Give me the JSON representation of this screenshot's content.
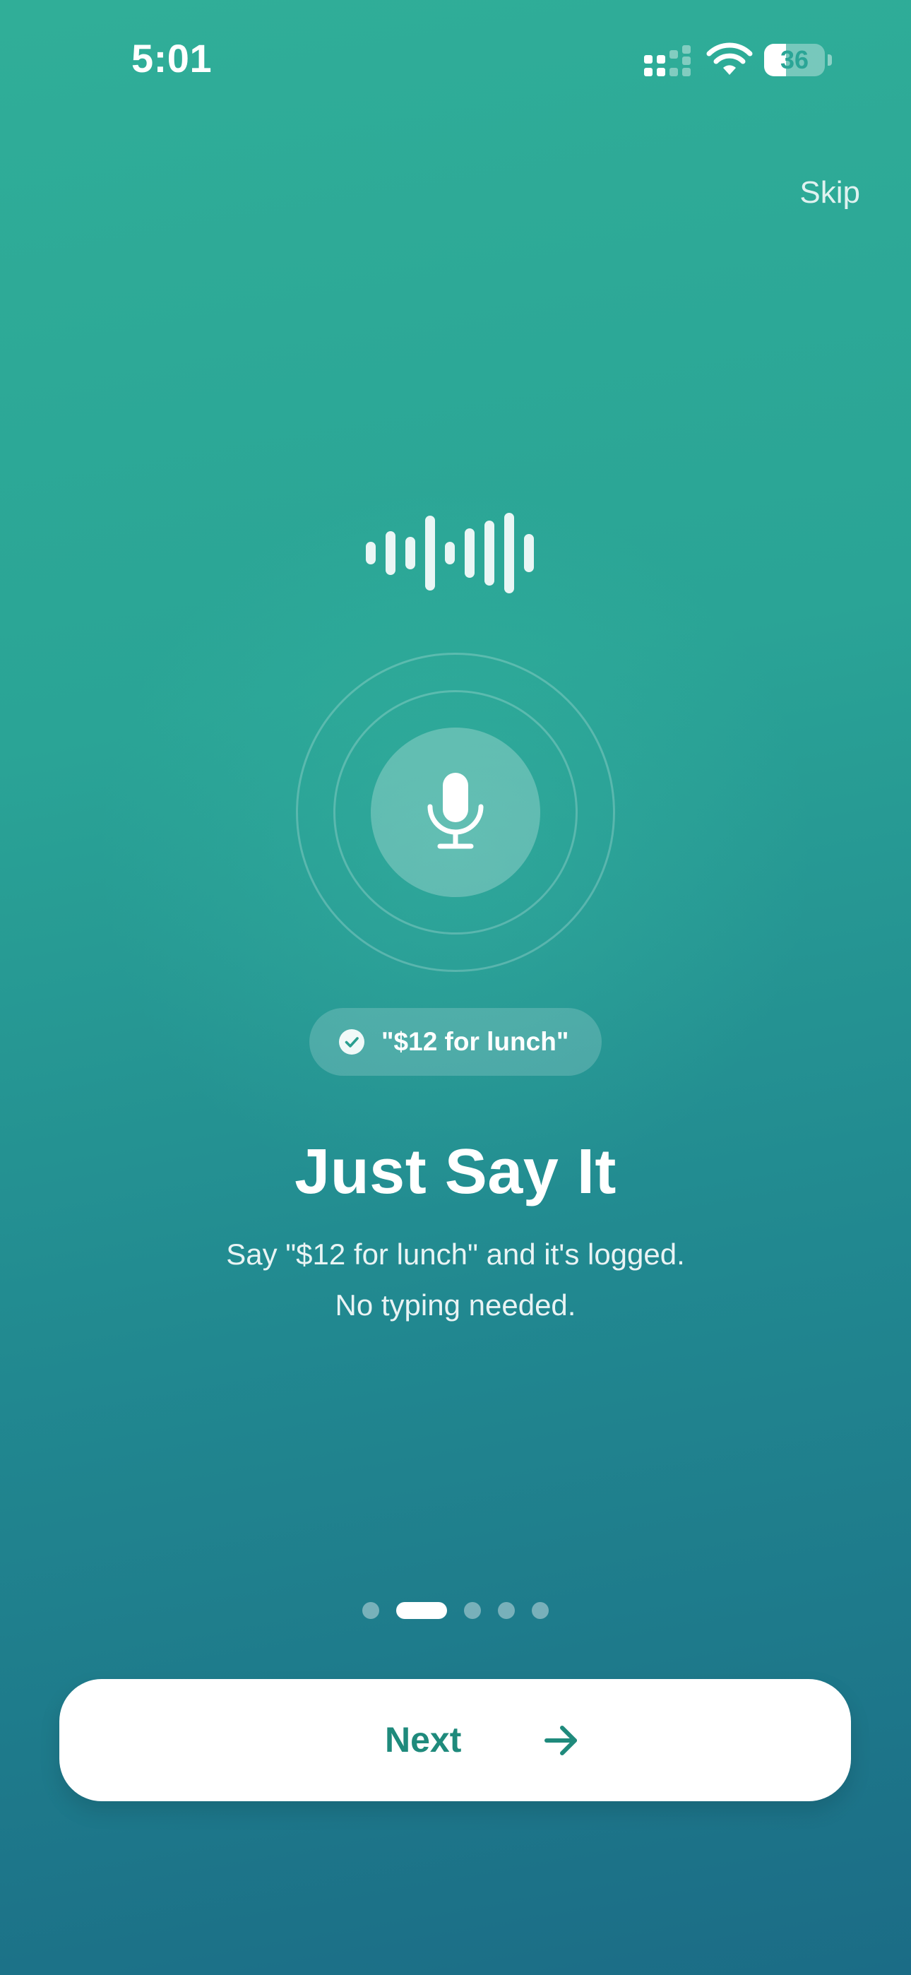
{
  "status_bar": {
    "time": "5:01",
    "battery_level": "36",
    "battery_fraction": 0.36
  },
  "header": {
    "skip_label": "Skip"
  },
  "hero": {
    "example_phrase": "\"$12 for lunch\""
  },
  "content": {
    "title": "Just Say It",
    "subtitle_line1": "Say \"$12 for lunch\" and it's logged.",
    "subtitle_line2": "No typing needed."
  },
  "pagination": {
    "total": 5,
    "active_index": 1
  },
  "footer": {
    "next_label": "Next"
  },
  "colors": {
    "gradient_top": "#30ae98",
    "gradient_bottom": "#1b6c86",
    "accent": "#1f8a7c",
    "text_primary": "#ffffff"
  },
  "icons": [
    "cellular-signal-icon",
    "wifi-icon",
    "battery-icon",
    "waveform-icon",
    "microphone-icon",
    "check-circle-icon",
    "arrow-right-icon"
  ]
}
